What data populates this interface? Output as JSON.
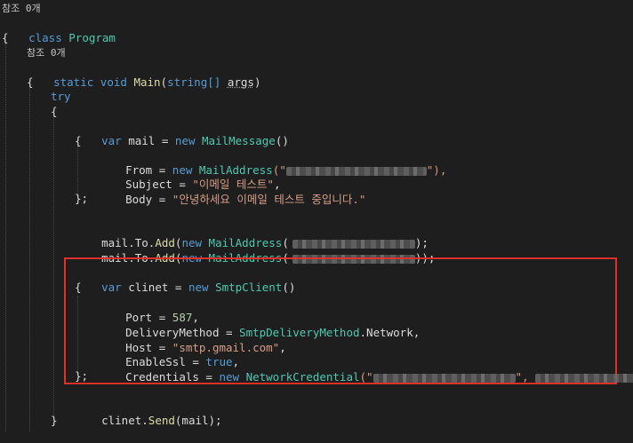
{
  "editor": {
    "theme_colors": {
      "background": "#1e1e1e",
      "keyword": "#569cd6",
      "type": "#4ec9b0",
      "method": "#dcdcaa",
      "string": "#d69d85",
      "highlight_border": "#e0302a"
    },
    "lines": {
      "ref_hint_class": "참조 0개",
      "class_kw": "class",
      "class_name": "Program",
      "open_brace_0": "{",
      "ref_hint_main": "참조 0개",
      "main_static": "static",
      "main_void": "void",
      "main_name": "Main",
      "main_param_open": "(",
      "main_param_type": "string[]",
      "main_param_name": "args",
      "main_param_close": ")",
      "open_brace_1": "{",
      "try_kw": "try",
      "open_brace_2": "{",
      "var_kw_1": "var",
      "mail_decl_rest": " mail = ",
      "new_kw_1": "new",
      "mailmessage_type": "MailMessage",
      "paren_empty_1": "()",
      "open_brace_3": "{",
      "from_prop": "From = ",
      "new_kw_2": "new",
      "mailaddress_type_1": "MailAddress",
      "from_open": "(\"",
      "from_close": "\"),",
      "subject_prop": "Subject = ",
      "subject_value": "\"이메일 테스트\"",
      "subject_comma": ",",
      "body_prop": "Body = ",
      "body_value": "\"안녕하세요 이메일 테스트 중입니다.\"",
      "close_brace_3": "};",
      "to_add_1_prefix": "mail.To.",
      "add_method_1": "Add",
      "to_add_1_open": "(",
      "new_kw_3": "new",
      "mailaddress_type_2": "MailAddress",
      "to_add_1_paren": "(",
      "to_add_1_close": ");",
      "to_add_2_prefix": "mail.To.",
      "add_method_2": "Add",
      "to_add_2_open": "(",
      "new_kw_4": "new",
      "mailaddress_type_3": "MailAddress",
      "to_add_2_paren": "(",
      "to_add_2_close": "));",
      "var_kw_2": "var",
      "client_decl_rest": " clinet = ",
      "new_kw_5": "new",
      "smtpclient_type": "SmtpClient",
      "paren_empty_2": "()",
      "open_brace_4": "{",
      "port_prop": "Port = ",
      "port_value": "587",
      "port_comma": ",",
      "delivery_prop": "DeliveryMethod = ",
      "delivery_type": "SmtpDeliveryMethod",
      "delivery_rest": ".Network,",
      "host_prop": "Host = ",
      "host_value": "\"smtp.gmail.com\"",
      "host_comma": ",",
      "ssl_prop": "EnableSsl = ",
      "ssl_value": "true",
      "ssl_comma": ",",
      "cred_prop": "Credentials = ",
      "new_kw_6": "new",
      "netcred_type": "NetworkCredential",
      "cred_open": "(\"",
      "cred_mid": "\", ",
      "cred_close": ")",
      "close_brace_4": "};",
      "send_prefix": "clinet.",
      "send_method": "Send",
      "send_rest": "(mail);",
      "close_brace_2": "}"
    }
  }
}
